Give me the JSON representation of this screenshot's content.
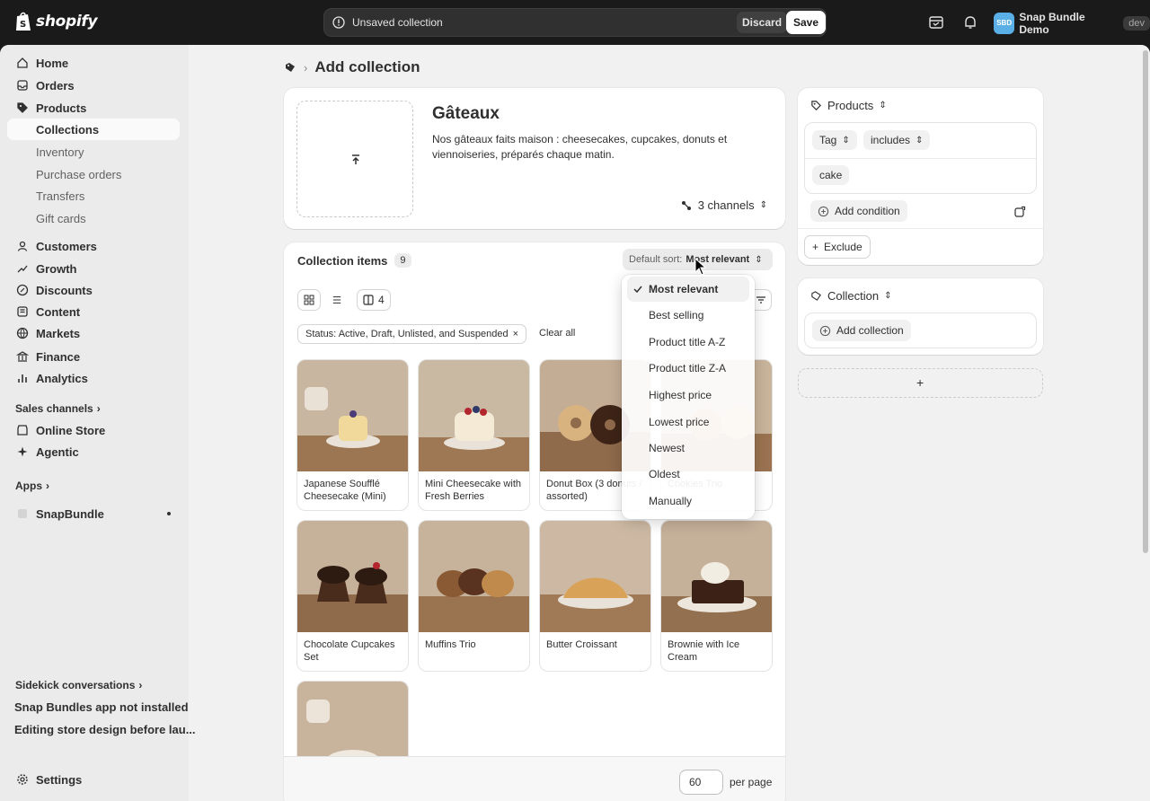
{
  "topbar": {
    "logo_text": "shopify",
    "savebar_text": "Unsaved collection",
    "discard_label": "Discard",
    "save_label": "Save",
    "store_initials": "SBD",
    "store_name": "Snap Bundle Demo",
    "store_badge": "dev"
  },
  "sidebar": {
    "items": [
      {
        "label": "Home",
        "icon": "home-icon"
      },
      {
        "label": "Orders",
        "icon": "inbox-icon"
      },
      {
        "label": "Products",
        "icon": "tag-icon"
      },
      {
        "label": "Collections"
      },
      {
        "label": "Inventory"
      },
      {
        "label": "Purchase orders"
      },
      {
        "label": "Transfers"
      },
      {
        "label": "Gift cards"
      },
      {
        "label": "Customers",
        "icon": "person-icon"
      },
      {
        "label": "Growth",
        "icon": "growth-icon"
      },
      {
        "label": "Discounts",
        "icon": "discount-icon"
      },
      {
        "label": "Content",
        "icon": "content-icon"
      },
      {
        "label": "Markets",
        "icon": "globe-icon"
      },
      {
        "label": "Finance",
        "icon": "bank-icon"
      },
      {
        "label": "Analytics",
        "icon": "chart-icon"
      }
    ],
    "sales_channels_label": "Sales channels",
    "channels": [
      {
        "label": "Online Store",
        "icon": "store-icon"
      },
      {
        "label": "Agentic",
        "icon": "sparkle-icon"
      }
    ],
    "apps_label": "Apps",
    "apps": [
      {
        "label": "SnapBundle",
        "icon": "app-icon"
      }
    ],
    "sidekick_label": "Sidekick conversations",
    "sidekick_items": [
      "Snap Bundles app not installed",
      "Editing store design before lau..."
    ],
    "settings_label": "Settings"
  },
  "page": {
    "title": "Add collection",
    "collection_title": "Gâteaux",
    "collection_description": "Nos gâteaux faits maison : cheesecakes, cupcakes, donuts et viennoiseries, préparés chaque matin.",
    "channels_label": "3 channels"
  },
  "items": {
    "title": "Collection items",
    "count": "9",
    "sort_prefix": "Default sort:",
    "sort_value": "Most relevant",
    "columns_label": "4",
    "status_filter": "Status: Active, Draft, Unlisted, and Suspended",
    "clear_all": "Clear all",
    "products": [
      "Japanese Soufflé Cheesecake (Mini)",
      "Mini Cheesecake with Fresh Berries",
      "Donut Box (3 donuts / assorted)",
      "Cookies Trio",
      "Chocolate Cupcakes Set",
      "Muffins Trio",
      "Butter Croissant",
      "Brownie with Ice Cream",
      ""
    ],
    "per_page_value": "60",
    "per_page_label": "per page"
  },
  "sort_menu": {
    "options": [
      "Most relevant",
      "Best selling",
      "Product title A-Z",
      "Product title Z-A",
      "Highest price",
      "Lowest price",
      "Newest",
      "Oldest",
      "Manually"
    ],
    "selected": "Most relevant"
  },
  "conditions": {
    "products_label": "Products",
    "field": "Tag",
    "operator": "includes",
    "value": "cake",
    "add_condition": "Add condition",
    "exclude": "Exclude"
  },
  "collection_rule": {
    "label": "Collection",
    "add_collection": "Add collection"
  },
  "colors": {
    "topbar": "#1a1a1a",
    "page_bg": "#f1f1f1",
    "card": "#ffffff",
    "avatar": "#5ab0e6"
  }
}
